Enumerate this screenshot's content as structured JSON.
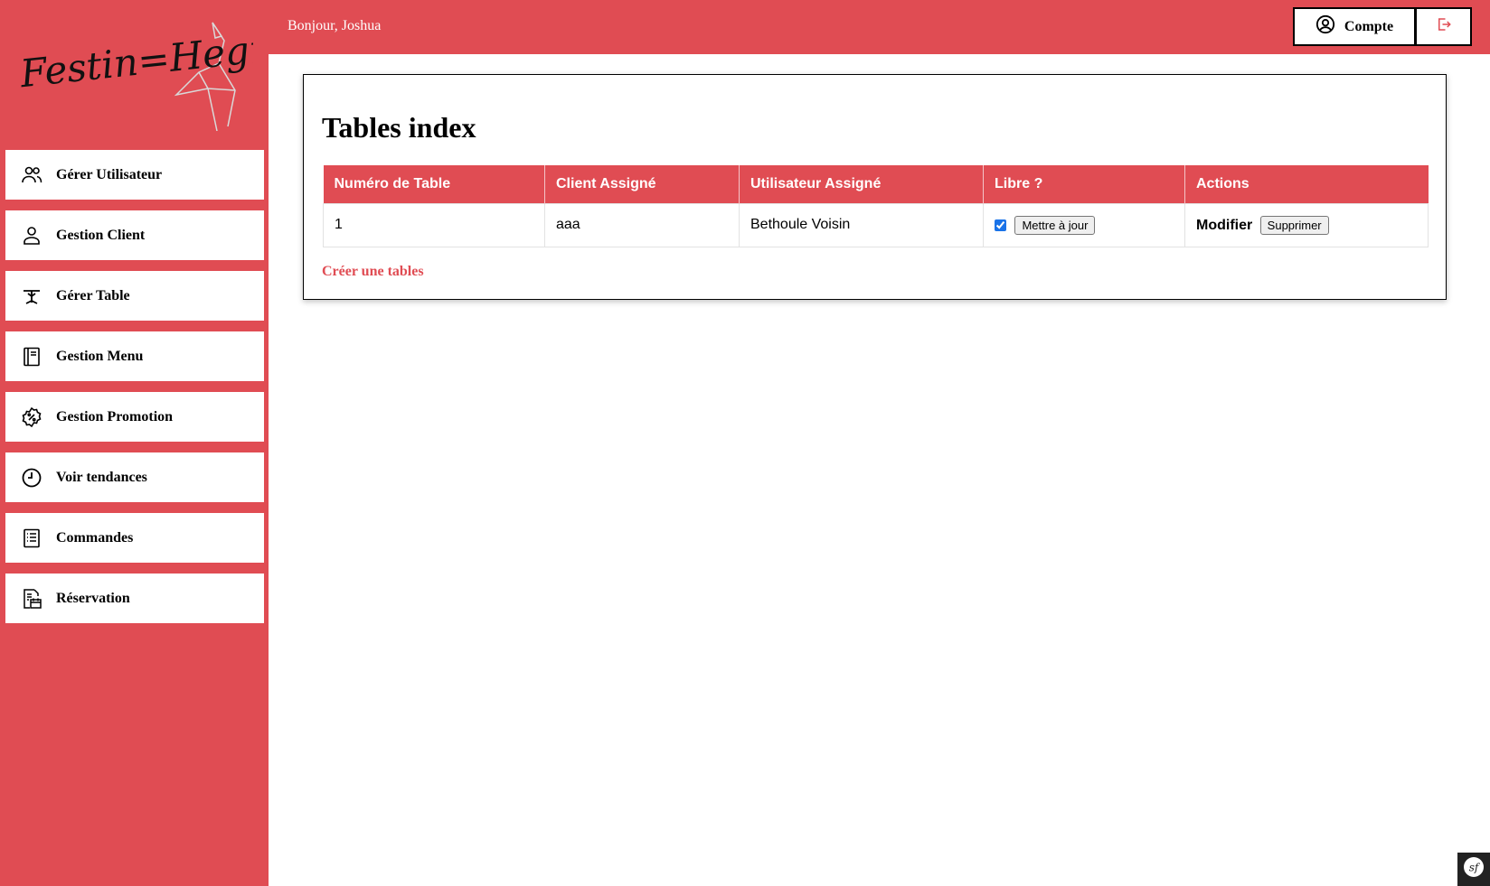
{
  "brand": {
    "logo_text": "Festin Hegre",
    "accent_color": "#e04c53"
  },
  "header": {
    "greeting": "Bonjour, Joshua",
    "account_label": "Compte",
    "account_icon": "user-circle-icon",
    "logout_icon": "logout-icon"
  },
  "sidebar": {
    "items": [
      {
        "label": "Gérer Utilisateur",
        "icon": "users-icon"
      },
      {
        "label": "Gestion Client",
        "icon": "user-icon"
      },
      {
        "label": "Gérer Table",
        "icon": "table-icon"
      },
      {
        "label": "Gestion Menu",
        "icon": "menu-book-icon"
      },
      {
        "label": "Gestion Promotion",
        "icon": "percent-badge-icon"
      },
      {
        "label": "Voir tendances",
        "icon": "clock-icon"
      },
      {
        "label": "Commandes",
        "icon": "list-icon"
      },
      {
        "label": "Réservation",
        "icon": "reservation-icon"
      }
    ]
  },
  "main": {
    "title": "Tables index",
    "table": {
      "columns": [
        "Numéro de Table",
        "Client Assigné",
        "Utilisateur Assigné",
        "Libre ?",
        "Actions"
      ],
      "rows": [
        {
          "numero": "1",
          "client": "aaa",
          "utilisateur": "Bethoule Voisin",
          "libre": true,
          "update_label": "Mettre à jour",
          "modify_label": "Modifier",
          "delete_label": "Supprimer"
        }
      ]
    },
    "create_link": "Créer une tables"
  },
  "debug_toolbar": {
    "icon": "symfony-icon",
    "text": "sf"
  }
}
